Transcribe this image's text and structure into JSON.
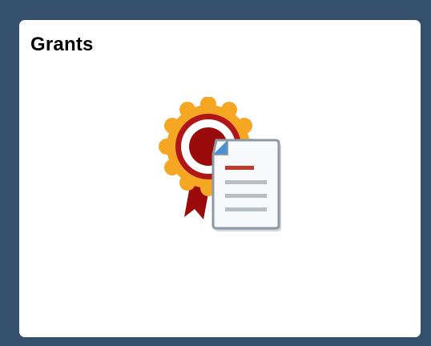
{
  "tile": {
    "title": "Grants",
    "icon": "grants-award-document-icon"
  },
  "colors": {
    "background": "#34506d",
    "tile": "#ffffff",
    "rosette_outer": "#f5a623",
    "rosette_ring": "#b01616",
    "rosette_center": "#9b0a0a",
    "ribbon": "#9b0a0a",
    "document": "#f7f9fb",
    "document_border": "#8c9aa6",
    "document_fold": "#4a90d9",
    "doc_red_line": "#c0392b",
    "doc_gray_line": "#b6bec6"
  }
}
